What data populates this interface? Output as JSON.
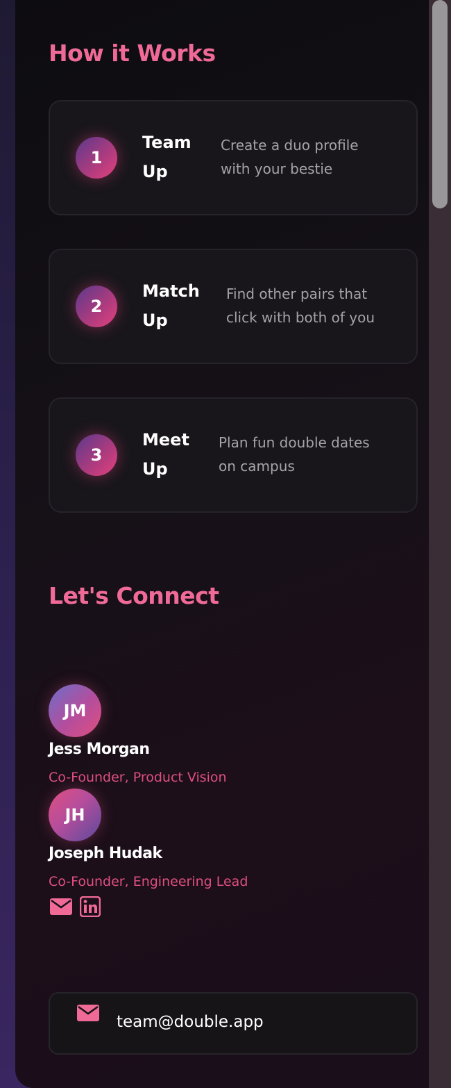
{
  "how_it_works": {
    "title": "How it Works",
    "steps": [
      {
        "number": "1",
        "title": "Team Up",
        "description": "Create a duo profile with your bestie"
      },
      {
        "number": "2",
        "title": "Match Up",
        "description": "Find other pairs that click with both of you"
      },
      {
        "number": "3",
        "title": "Meet Up",
        "description": "Plan fun double dates on campus"
      }
    ]
  },
  "connect": {
    "title": "Let's Connect",
    "team": [
      {
        "initials": "JM",
        "name": "Jess Morgan",
        "role": "Co-Founder, Product Vision"
      },
      {
        "initials": "JH",
        "name": "Joseph Hudak",
        "role": "Co-Founder, Engineering Lead"
      }
    ],
    "social_icons": [
      "mail-icon",
      "linkedin-icon"
    ],
    "contact": {
      "icon": "mail-icon",
      "email": "team@double.app"
    }
  },
  "colors": {
    "accent": "#f06a97",
    "role": "#e0507f",
    "card": "#18161b"
  }
}
